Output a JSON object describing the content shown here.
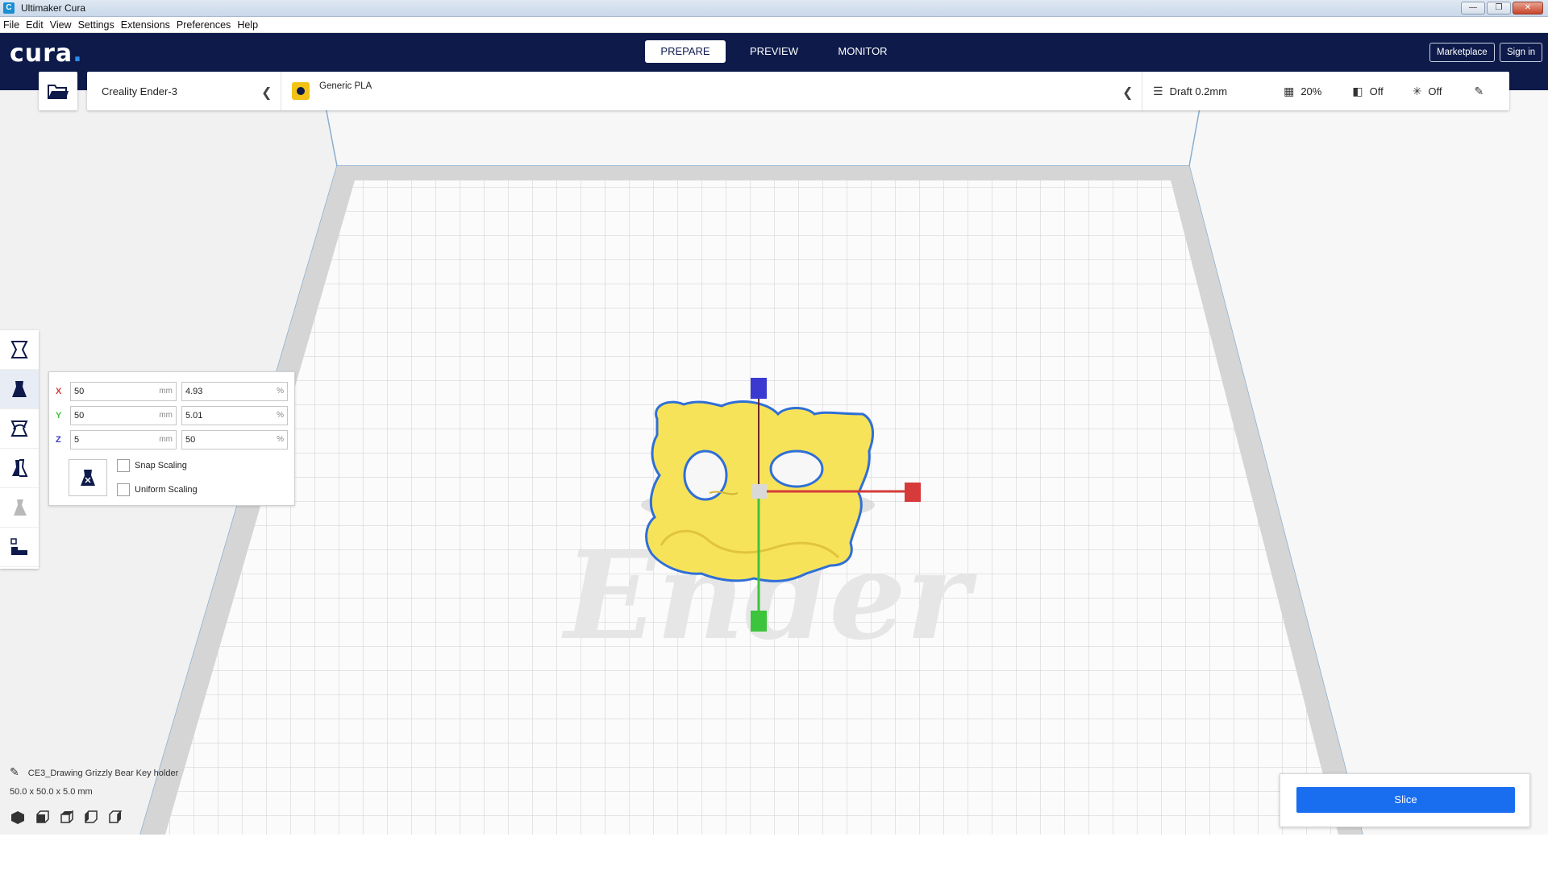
{
  "window": {
    "title": "Ultimaker Cura",
    "app_icon": "C"
  },
  "menu": [
    {
      "label": "File"
    },
    {
      "label": "Edit"
    },
    {
      "label": "View"
    },
    {
      "label": "Settings"
    },
    {
      "label": "Extensions"
    },
    {
      "label": "Preferences"
    },
    {
      "label": "Help"
    }
  ],
  "header": {
    "logo": "cura",
    "logo_dot": ".",
    "tabs": [
      {
        "label": "PREPARE"
      },
      {
        "label": "PREVIEW"
      },
      {
        "label": "MONITOR"
      }
    ],
    "active_tab": "PREPARE",
    "marketplace": "Marketplace",
    "sign_in": "Sign in"
  },
  "toolbar": {
    "printer": "Creality Ender-3",
    "material": "Generic PLA",
    "profile": "Draft 0.2mm",
    "infill": "20%",
    "support": "Off",
    "adhesion": "Off"
  },
  "scale": {
    "x_label": "X",
    "y_label": "Y",
    "z_label": "Z",
    "x_mm": "50",
    "y_mm": "50",
    "z_mm": "5",
    "x_pct": "4.93",
    "y_pct": "5.01",
    "z_pct": "50",
    "mm_unit": "mm",
    "pct_unit": "%",
    "snap": "Snap Scaling",
    "uniform": "Uniform Scaling",
    "snap_checked": false,
    "uniform_checked": false
  },
  "object": {
    "name": "CE3_Drawing  Grizzly Bear Key holder",
    "dimensions": "50.0 x 50.0 x 5.0 mm"
  },
  "slice": {
    "label": "Slice"
  },
  "colors": {
    "header_bg": "#0d1a4a",
    "accent": "#196ef0",
    "model": "#f7e35a",
    "model_outline": "#2f6fd6",
    "material_badge": "#f2c316",
    "x_axis": "#d63a3a",
    "y_axis": "#3cc43c",
    "z_axis": "#3a3ad0"
  }
}
